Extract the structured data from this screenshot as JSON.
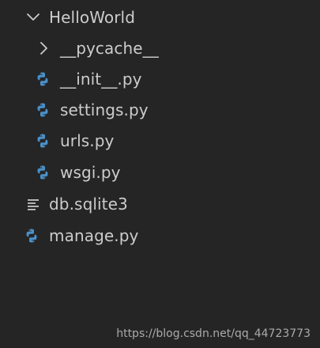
{
  "explorer": {
    "root_folder": {
      "label": "HelloWorld",
      "expanded": true,
      "twisty_icon": "chevron-down-icon"
    },
    "children": [
      {
        "label": "__pycache__",
        "kind": "folder",
        "expanded": false,
        "icon": "chevron-right-icon"
      },
      {
        "label": "__init__.py",
        "kind": "file",
        "icon": "python-icon"
      },
      {
        "label": "settings.py",
        "kind": "file",
        "icon": "python-icon"
      },
      {
        "label": "urls.py",
        "kind": "file",
        "icon": "python-icon"
      },
      {
        "label": "wsgi.py",
        "kind": "file",
        "icon": "python-icon"
      }
    ],
    "top_level_files": [
      {
        "label": "db.sqlite3",
        "kind": "file",
        "icon": "lines-icon"
      },
      {
        "label": "manage.py",
        "kind": "file",
        "icon": "python-icon"
      }
    ]
  },
  "watermark": "https://blog.csdn.net/qq_44723773",
  "colors": {
    "background": "#252526",
    "text": "#cccccc",
    "python_blue": "#4a90c8",
    "icon_gray": "#c5c5c5"
  }
}
